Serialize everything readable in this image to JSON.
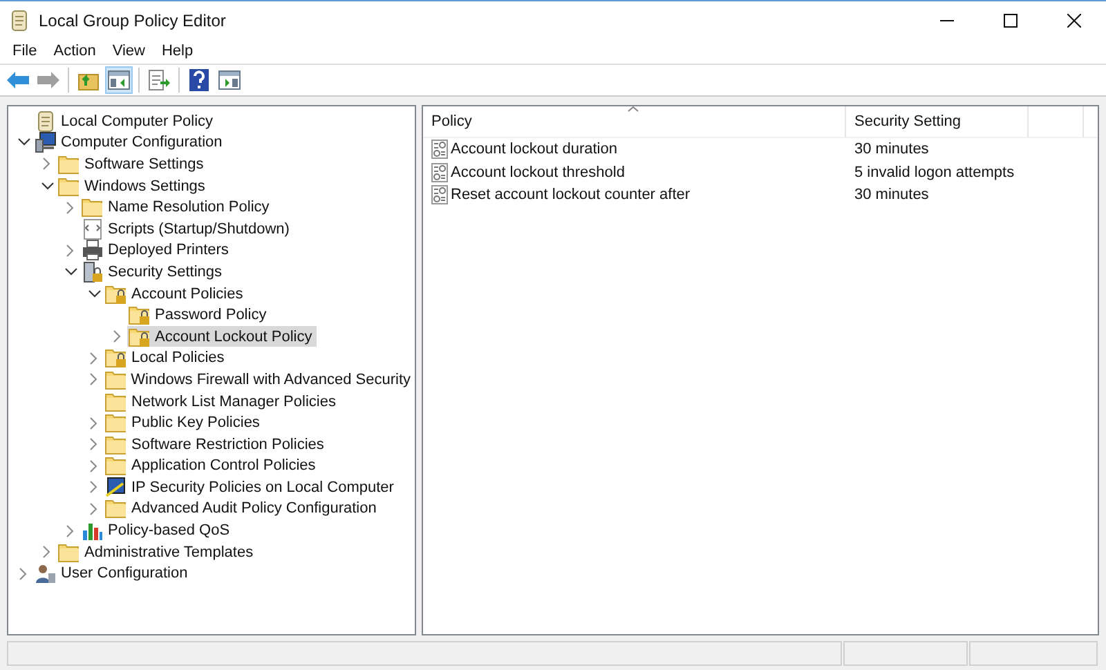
{
  "window": {
    "title": "Local Group Policy Editor"
  },
  "menu": [
    "File",
    "Action",
    "View",
    "Help"
  ],
  "toolbar": [
    {
      "kind": "back",
      "disabled": false,
      "pressed": false
    },
    {
      "kind": "forward",
      "disabled": true,
      "pressed": false
    },
    {
      "kind": "sep"
    },
    {
      "kind": "up",
      "disabled": false,
      "pressed": false
    },
    {
      "kind": "tree",
      "disabled": false,
      "pressed": true
    },
    {
      "kind": "sep"
    },
    {
      "kind": "export",
      "disabled": false,
      "pressed": false
    },
    {
      "kind": "sep"
    },
    {
      "kind": "help",
      "disabled": false,
      "pressed": false
    },
    {
      "kind": "pane",
      "disabled": false,
      "pressed": false
    }
  ],
  "tree": [
    {
      "label": "Local Computer Policy",
      "kind": "scroll",
      "selected": false,
      "children": [
        {
          "label": "Computer Configuration",
          "kind": "computer",
          "expanded": true,
          "selected": false,
          "children": [
            {
              "label": "Software Settings",
              "kind": "folder",
              "expanded": false,
              "selected": false
            },
            {
              "label": "Windows Settings",
              "kind": "folder",
              "expanded": true,
              "selected": false,
              "children": [
                {
                  "label": "Name Resolution Policy",
                  "kind": "folder",
                  "expanded": false,
                  "selected": false
                },
                {
                  "label": "Scripts (Startup/Shutdown)",
                  "kind": "scripts",
                  "selected": false
                },
                {
                  "label": "Deployed Printers",
                  "kind": "printer",
                  "expanded": false,
                  "selected": false
                },
                {
                  "label": "Security Settings",
                  "kind": "security",
                  "expanded": true,
                  "selected": false,
                  "children": [
                    {
                      "label": "Account Policies",
                      "kind": "lockfolder",
                      "expanded": true,
                      "selected": false,
                      "children": [
                        {
                          "label": "Password Policy",
                          "kind": "lockfolder",
                          "selected": false
                        },
                        {
                          "label": "Account Lockout Policy",
                          "kind": "lockfolder",
                          "expanded": false,
                          "selected": true
                        }
                      ]
                    },
                    {
                      "label": "Local Policies",
                      "kind": "lockfolder",
                      "expanded": false,
                      "selected": false
                    },
                    {
                      "label": "Windows Firewall with Advanced Security",
                      "kind": "folder",
                      "expanded": false,
                      "selected": false
                    },
                    {
                      "label": "Network List Manager Policies",
                      "kind": "folder",
                      "selected": false
                    },
                    {
                      "label": "Public Key Policies",
                      "kind": "folder",
                      "expanded": false,
                      "selected": false
                    },
                    {
                      "label": "Software Restriction Policies",
                      "kind": "folder",
                      "expanded": false,
                      "selected": false
                    },
                    {
                      "label": "Application Control Policies",
                      "kind": "folder",
                      "expanded": false,
                      "selected": false
                    },
                    {
                      "label": "IP Security Policies on Local Computer",
                      "kind": "ipsec",
                      "expanded": false,
                      "selected": false
                    },
                    {
                      "label": "Advanced Audit Policy Configuration",
                      "kind": "folder",
                      "expanded": false,
                      "selected": false
                    }
                  ]
                },
                {
                  "label": "Policy-based QoS",
                  "kind": "chart",
                  "expanded": false,
                  "selected": false
                }
              ]
            },
            {
              "label": "Administrative Templates",
              "kind": "folder",
              "expanded": false,
              "selected": false
            }
          ]
        },
        {
          "label": "User Configuration",
          "kind": "user",
          "expanded": false,
          "selected": false
        }
      ]
    }
  ],
  "table": {
    "columns": [
      "Policy",
      "Security Setting"
    ],
    "rows": [
      {
        "policy": "Account lockout duration",
        "setting": "30 minutes"
      },
      {
        "policy": "Account lockout threshold",
        "setting": "5 invalid logon attempts"
      },
      {
        "policy": "Reset account lockout counter after",
        "setting": "30 minutes"
      }
    ]
  }
}
